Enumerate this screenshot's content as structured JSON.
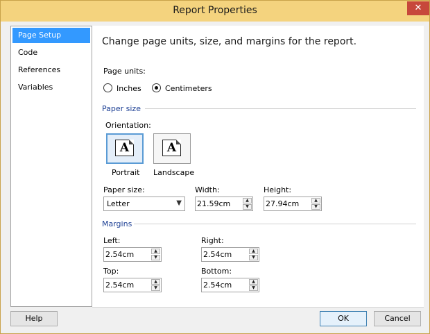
{
  "window": {
    "title": "Report Properties",
    "close_glyph": "✕"
  },
  "nav": {
    "items": [
      {
        "label": "Page Setup",
        "selected": true
      },
      {
        "label": "Code",
        "selected": false
      },
      {
        "label": "References",
        "selected": false
      },
      {
        "label": "Variables",
        "selected": false
      }
    ]
  },
  "page_setup": {
    "heading": "Change page units, size, and margins for the report.",
    "page_units": {
      "label": "Page units:",
      "options": [
        {
          "label": "Inches",
          "checked": false
        },
        {
          "label": "Centimeters",
          "checked": true
        }
      ]
    },
    "paper_size_group": {
      "title": "Paper size",
      "orientation_label": "Orientation:",
      "orientations": [
        {
          "label": "Portrait",
          "glyph": "A",
          "selected": true
        },
        {
          "label": "Landscape",
          "glyph": "A",
          "selected": false
        }
      ],
      "paper_size_label": "Paper size:",
      "paper_size_value": "Letter",
      "width_label": "Width:",
      "width_value": "21.59cm",
      "height_label": "Height:",
      "height_value": "27.94cm"
    },
    "margins_group": {
      "title": "Margins",
      "left_label": "Left:",
      "left_value": "2.54cm",
      "right_label": "Right:",
      "right_value": "2.54cm",
      "top_label": "Top:",
      "top_value": "2.54cm",
      "bottom_label": "Bottom:",
      "bottom_value": "2.54cm"
    }
  },
  "buttons": {
    "help": "Help",
    "ok": "OK",
    "cancel": "Cancel"
  },
  "glyphs": {
    "dropdown": "▼",
    "spin_up": "▲",
    "spin_down": "▼"
  },
  "colors": {
    "titlebar": "#f4d37e",
    "close_button": "#c7483b",
    "nav_selected": "#3399ff",
    "group_title": "#1c3f94"
  }
}
